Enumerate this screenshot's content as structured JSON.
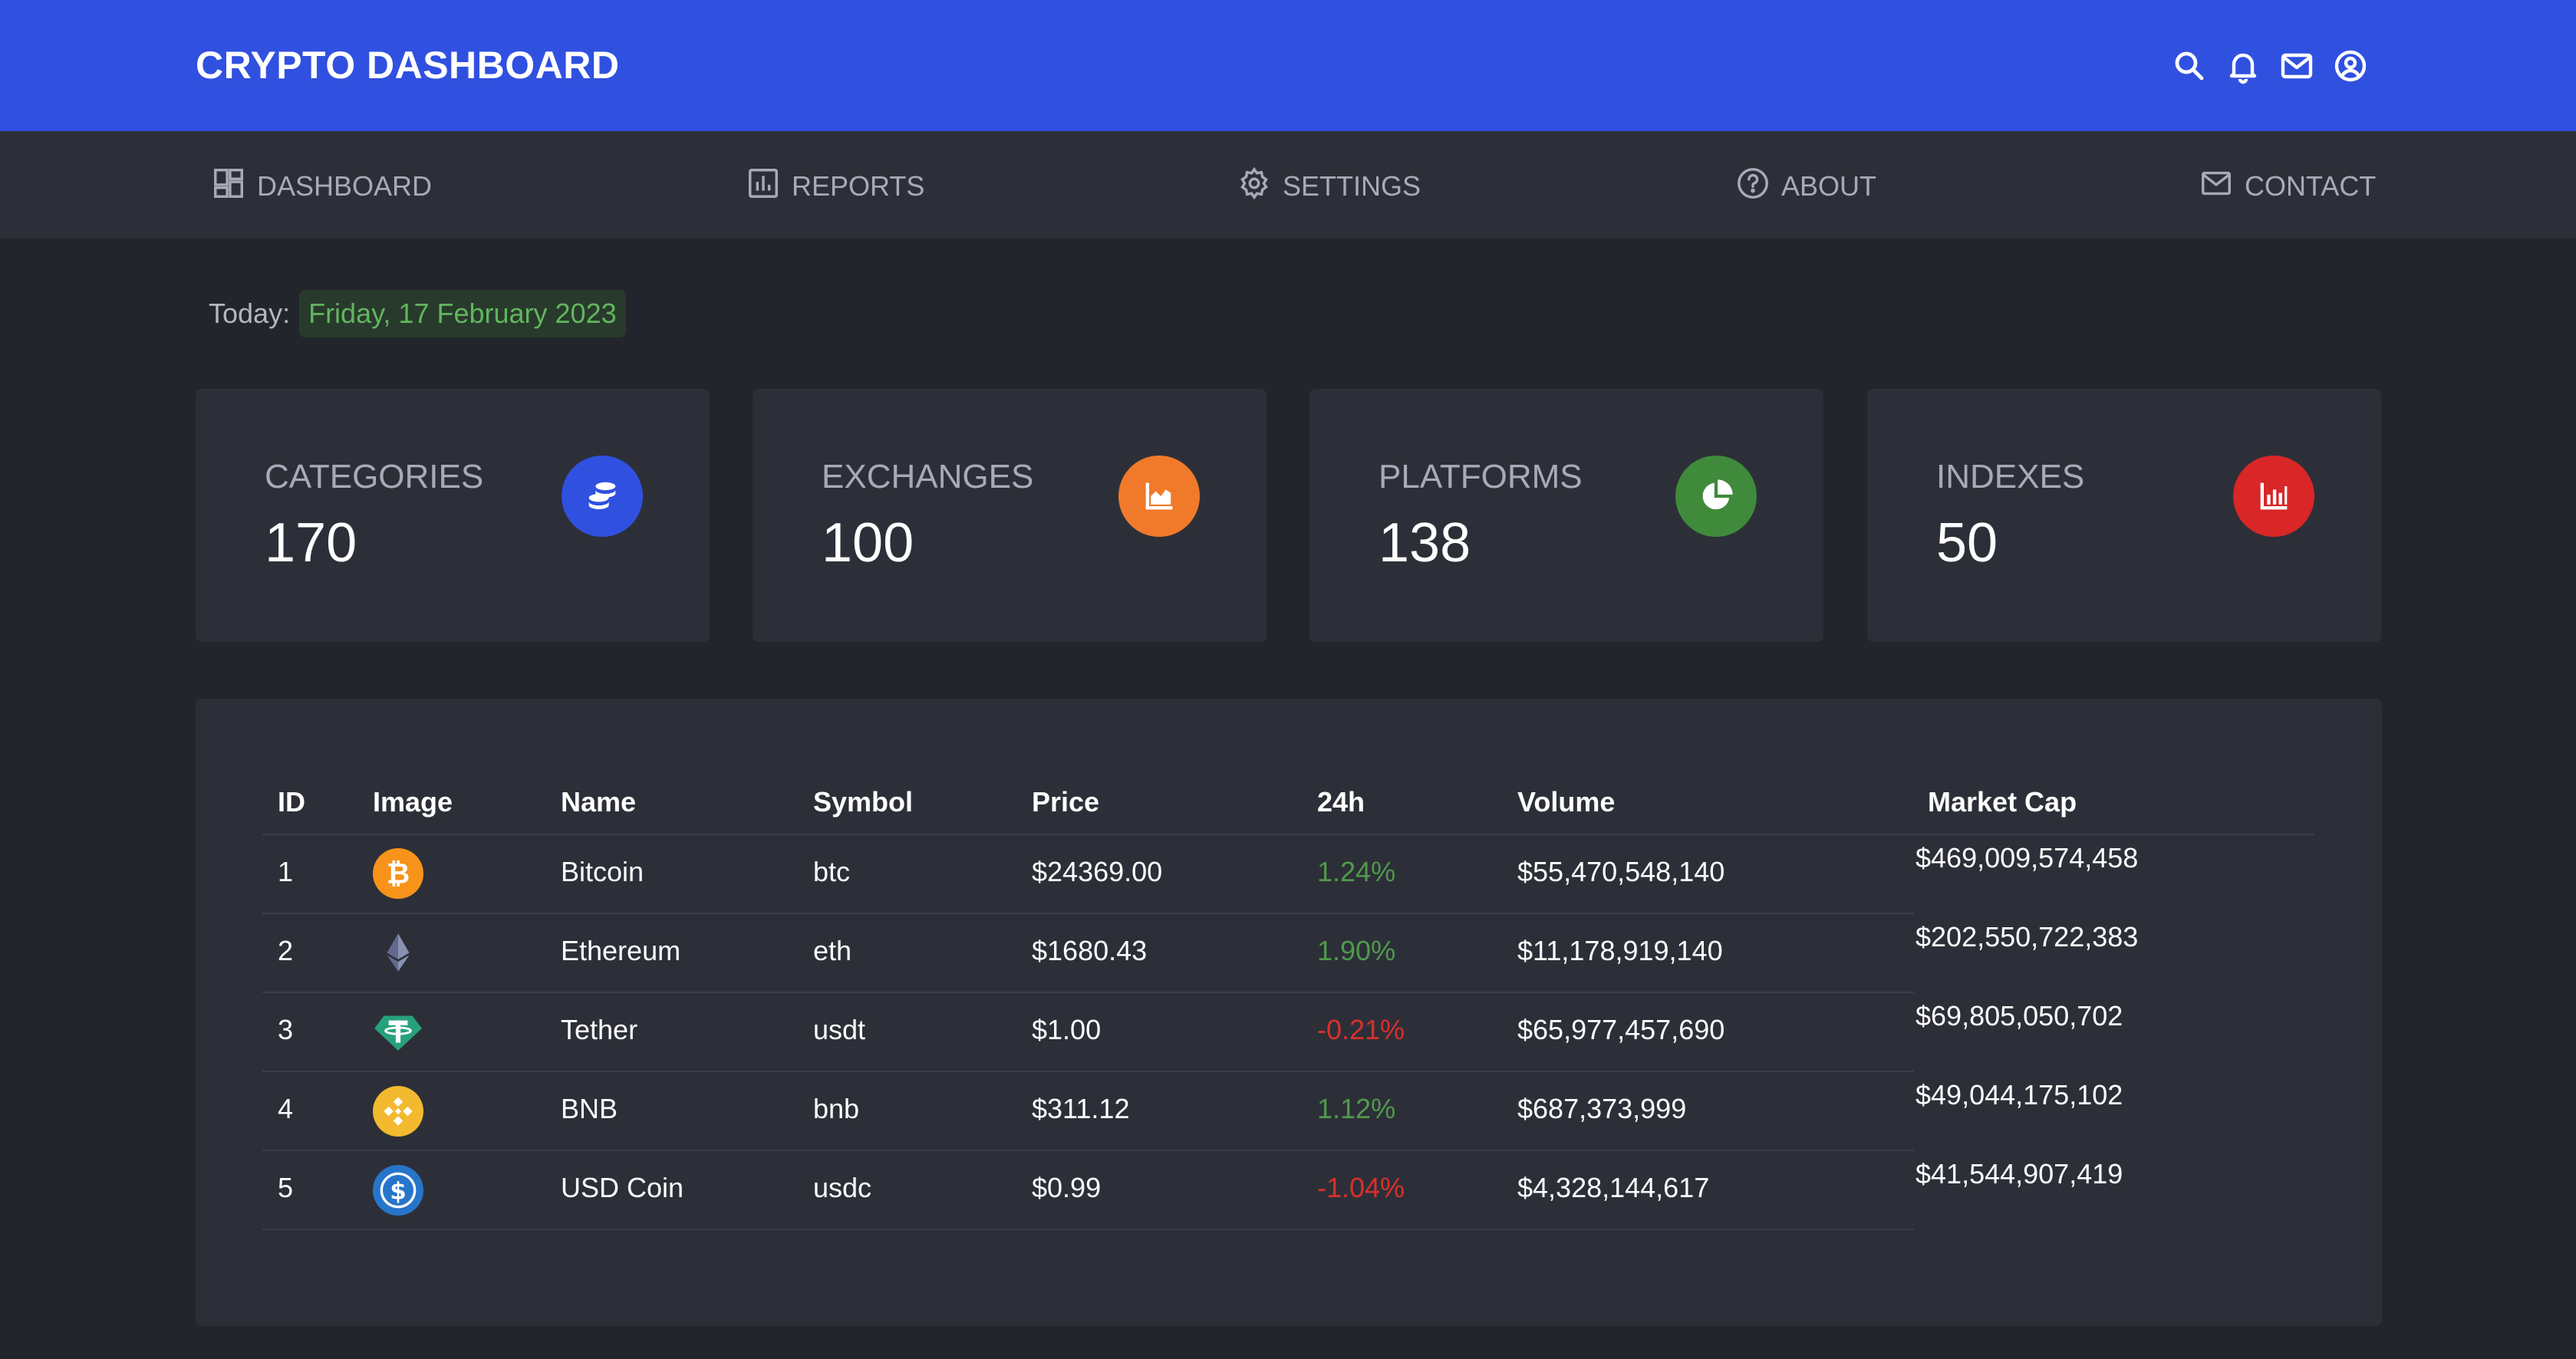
{
  "header": {
    "title": "CRYPTO DASHBOARD",
    "icons": [
      "search-icon",
      "bell-icon",
      "mail-icon",
      "user-icon"
    ]
  },
  "nav": [
    {
      "label": "DASHBOARD",
      "icon": "dashboard-icon"
    },
    {
      "label": "REPORTS",
      "icon": "reports-icon"
    },
    {
      "label": "SETTINGS",
      "icon": "gear-icon"
    },
    {
      "label": "ABOUT",
      "icon": "help-icon"
    },
    {
      "label": "CONTACT",
      "icon": "mail-icon"
    }
  ],
  "today": {
    "label": "Today:",
    "date": "Friday, 17 February 2023"
  },
  "cards": [
    {
      "label": "CATEGORIES",
      "value": "170",
      "icon": "coins-icon",
      "color": "#3050e0"
    },
    {
      "label": "EXCHANGES",
      "value": "100",
      "icon": "area-chart-icon",
      "color": "#f07a2a"
    },
    {
      "label": "PLATFORMS",
      "value": "138",
      "icon": "pie-chart-icon",
      "color": "#3f8a3b"
    },
    {
      "label": "INDEXES",
      "value": "50",
      "icon": "bar-chart-icon",
      "color": "#d92626"
    }
  ],
  "table": {
    "headers": [
      "ID",
      "Image",
      "Name",
      "Symbol",
      "Price",
      "24h",
      "Volume",
      "Market Cap"
    ],
    "rows": [
      {
        "id": "1",
        "image": "bitcoin-icon",
        "name": "Bitcoin",
        "symbol": "btc",
        "price": "$24369.00",
        "change": "1.24%",
        "volume": "$55,470,548,140",
        "market_cap": "$469,009,574,458"
      },
      {
        "id": "2",
        "image": "ethereum-icon",
        "name": "Ethereum",
        "symbol": "eth",
        "price": "$1680.43",
        "change": "1.90%",
        "volume": "$11,178,919,140",
        "market_cap": "$202,550,722,383"
      },
      {
        "id": "3",
        "image": "tether-icon",
        "name": "Tether",
        "symbol": "usdt",
        "price": "$1.00",
        "change": "-0.21%",
        "volume": "$65,977,457,690",
        "market_cap": "$69,805,050,702"
      },
      {
        "id": "4",
        "image": "bnb-icon",
        "name": "BNB",
        "symbol": "bnb",
        "price": "$311.12",
        "change": "1.12%",
        "volume": "$687,373,999",
        "market_cap": "$49,044,175,102"
      },
      {
        "id": "5",
        "image": "usd-coin-icon",
        "name": "USD Coin",
        "symbol": "usdc",
        "price": "$0.99",
        "change": "-1.04%",
        "volume": "$4,328,144,617",
        "market_cap": "$41,544,907,419"
      }
    ]
  },
  "colors": {
    "header": "#3050e0",
    "background": "#23252c",
    "panel": "#2d2f38",
    "positive": "#4f9a4c",
    "negative": "#d9302c",
    "date": "#62b55f"
  }
}
